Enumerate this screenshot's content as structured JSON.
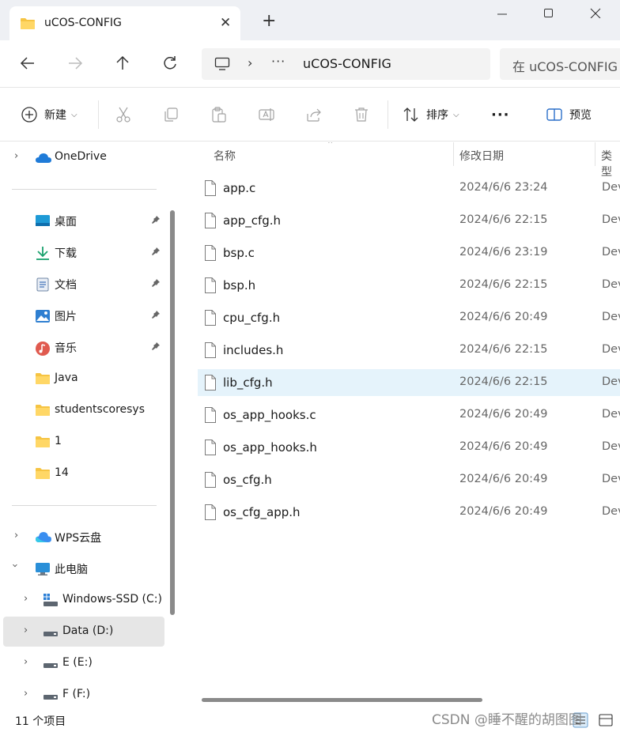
{
  "tab": {
    "title": "uCOS-CONFIG"
  },
  "address": {
    "dots": "···",
    "current": "uCOS-CONFIG"
  },
  "search": {
    "placeholder": "在 uCOS-CONFIG 中搜索"
  },
  "toolbar": {
    "new_label": "新建",
    "sort_label": "排序",
    "more_label": "···",
    "preview_label": "预览"
  },
  "nav": {
    "onedrive": "OneDrive",
    "quick": [
      {
        "label": "桌面"
      },
      {
        "label": "下载"
      },
      {
        "label": "文档"
      },
      {
        "label": "图片"
      },
      {
        "label": "音乐"
      },
      {
        "label": "Java"
      },
      {
        "label": "studentscoresys"
      },
      {
        "label": "1"
      },
      {
        "label": "14"
      }
    ],
    "wps": "WPS云盘",
    "pc": "此电脑",
    "drives": [
      {
        "label": "Windows-SSD (C:)"
      },
      {
        "label": "Data (D:)"
      },
      {
        "label": "E (E:)"
      },
      {
        "label": "F (F:)"
      }
    ]
  },
  "columns": {
    "name": "名称",
    "date": "修改日期",
    "type": "类型"
  },
  "files": [
    {
      "name": "app.c",
      "date": "2024/6/6 23:24",
      "type": "Dev"
    },
    {
      "name": "app_cfg.h",
      "date": "2024/6/6 22:15",
      "type": "Dev"
    },
    {
      "name": "bsp.c",
      "date": "2024/6/6 23:19",
      "type": "Dev"
    },
    {
      "name": "bsp.h",
      "date": "2024/6/6 22:15",
      "type": "Dev"
    },
    {
      "name": "cpu_cfg.h",
      "date": "2024/6/6 20:49",
      "type": "Dev"
    },
    {
      "name": "includes.h",
      "date": "2024/6/6 22:15",
      "type": "Dev"
    },
    {
      "name": "lib_cfg.h",
      "date": "2024/6/6 22:15",
      "type": "Dev"
    },
    {
      "name": "os_app_hooks.c",
      "date": "2024/6/6 20:49",
      "type": "Dev"
    },
    {
      "name": "os_app_hooks.h",
      "date": "2024/6/6 20:49",
      "type": "Dev"
    },
    {
      "name": "os_cfg.h",
      "date": "2024/6/6 20:49",
      "type": "Dev"
    },
    {
      "name": "os_cfg_app.h",
      "date": "2024/6/6 20:49",
      "type": "Dev"
    }
  ],
  "status": {
    "count": "11 个项目"
  },
  "watermark": "CSDN @睡不醒的胡图图"
}
